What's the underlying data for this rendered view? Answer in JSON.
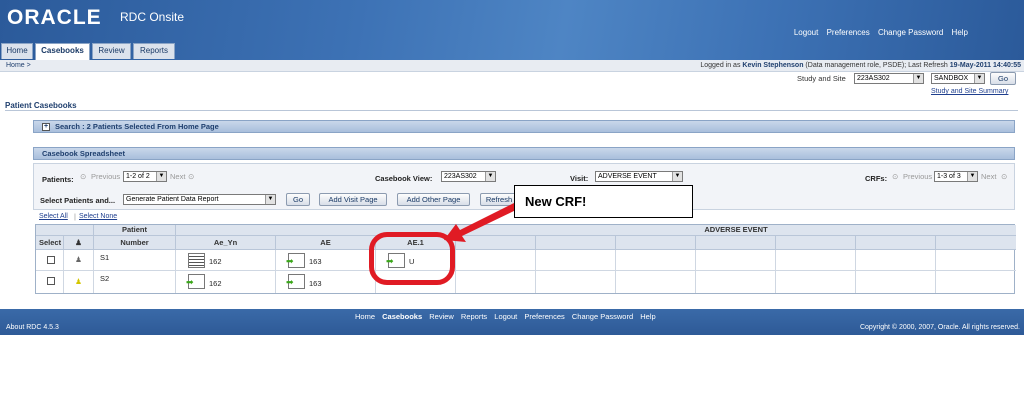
{
  "app": {
    "logo": "ORACLE",
    "title": "RDC Onsite"
  },
  "top_links": [
    "Logout",
    "Preferences",
    "Change Password",
    "Help"
  ],
  "tabs": [
    "Home",
    "Casebooks",
    "Review",
    "Reports"
  ],
  "breadcrumb": "Home >",
  "session": {
    "prefix": "Logged in as ",
    "user": "Kevin Stephenson",
    "role": " (Data management role, PSDE); Last Refresh ",
    "refresh": "19-May-2011 14:40:55"
  },
  "study": {
    "label": "Study and Site",
    "study_value": "223AS302",
    "site_value": "SANDBOX",
    "go": "Go",
    "summary_link": "Study and Site Summary"
  },
  "page_title": "Patient Casebooks",
  "search_section": {
    "expander": "+",
    "title": "Search : 2 Patients Selected From Home Page"
  },
  "spreadsheet": {
    "title": "Casebook Spreadsheet",
    "patients_label": "Patients:",
    "previous": "Previous",
    "patients_range": "1-2 of 2",
    "next": "Next",
    "casebook_view_label": "Casebook View:",
    "casebook_view_value": "223AS302",
    "visit_label": "Visit:",
    "visit_value": "ADVERSE EVENT",
    "crfs_label": "CRFs:",
    "crfs_range": "1-3 of 3",
    "select_patients_label": "Select Patients and...",
    "action_value": "Generate Patient Data Report",
    "buttons": {
      "go": "Go",
      "add_visit": "Add Visit Page",
      "add_other": "Add Other Page",
      "refresh": "Refresh"
    },
    "select_all": "Select All",
    "select_none": "Select None"
  },
  "table": {
    "headers": {
      "select": "Select",
      "patient_top": "Patient",
      "patient_bottom": "Number",
      "ae_yn": "Ae_Yn",
      "ae": "AE",
      "ae1": "AE.1",
      "visit_group": "ADVERSE EVENT"
    },
    "rows": [
      {
        "patient": "S1",
        "ae_yn": "162",
        "ae": "163",
        "ae1": "U"
      },
      {
        "patient": "S2",
        "ae_yn": "162",
        "ae": "163",
        "ae1": ""
      }
    ]
  },
  "callout": "New CRF!",
  "footer": {
    "links": [
      "Home",
      "Casebooks",
      "Review",
      "Reports",
      "Logout",
      "Preferences",
      "Change Password",
      "Help"
    ],
    "about": "About RDC 4.5.3",
    "copyright": "Copyright © 2000, 2007, Oracle. All rights reserved."
  },
  "colors": {
    "brand": "#3d72b5",
    "callout_ring": "#e01b24",
    "new_crf_arrow": "#3aa619"
  }
}
